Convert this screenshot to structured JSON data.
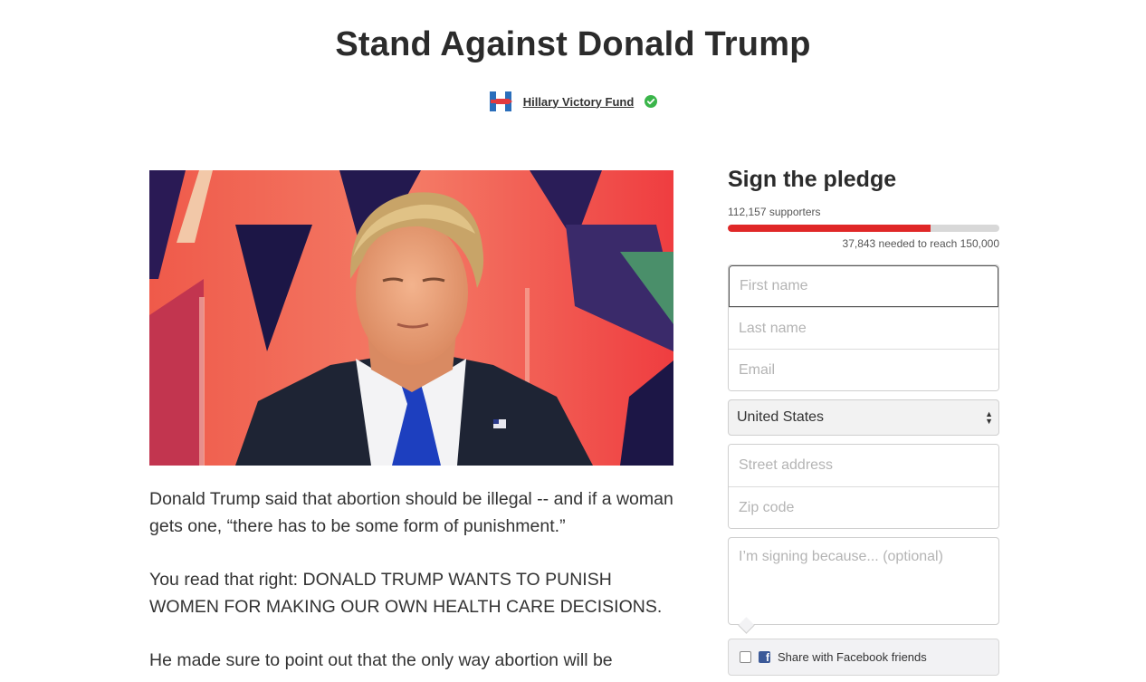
{
  "page": {
    "title": "Stand Against Donald Trump"
  },
  "organization": {
    "name": "Hillary Victory Fund",
    "logo_icon": "hillary-h-logo-icon",
    "verified_icon": "verified-check-icon",
    "logo_colors": {
      "blue": "#2a6ebb",
      "red": "#e23a3f"
    },
    "verified_color": "#3ab54a"
  },
  "hero": {
    "image_description_icon": "donald-trump-photo"
  },
  "body": {
    "paragraphs": [
      "Donald Trump said that abortion should be illegal -- and if a woman gets one, “there has to be some form of punishment.”",
      "You read that right: DONALD TRUMP WANTS TO PUNISH WOMEN FOR MAKING OUR OWN HEALTH CARE DECISIONS.",
      "He made sure to point out that the only way abortion will be"
    ]
  },
  "pledge": {
    "heading": "Sign the pledge",
    "supporters_text": "112,157 supporters",
    "progress_fraction": 0.7477,
    "needed_text": "37,843 needed to reach 150,000",
    "progress_color": "#e02727",
    "fields": {
      "first_name_placeholder": "First name",
      "last_name_placeholder": "Last name",
      "email_placeholder": "Email",
      "country_value": "United States",
      "street_placeholder": "Street address",
      "zip_placeholder": "Zip code",
      "reason_placeholder": "I’m signing because... (optional)"
    },
    "share": {
      "label": "Share with Facebook friends",
      "checked": false,
      "icon": "facebook-icon"
    }
  }
}
